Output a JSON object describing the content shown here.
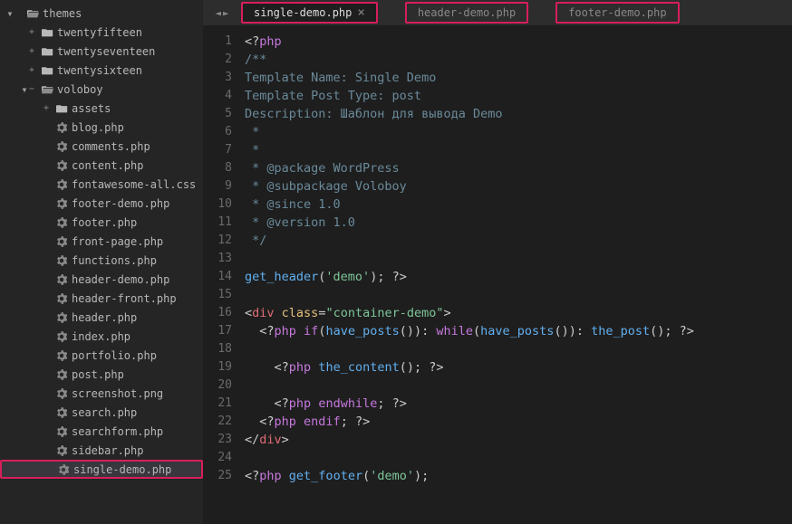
{
  "sidebar": {
    "tree": [
      {
        "depth": 0,
        "chev": "▾",
        "plus": "",
        "type": "folder-open",
        "label": "themes"
      },
      {
        "depth": 1,
        "chev": "",
        "plus": "+",
        "type": "folder",
        "label": "twentyfifteen"
      },
      {
        "depth": 1,
        "chev": "",
        "plus": "+",
        "type": "folder",
        "label": "twentyseventeen"
      },
      {
        "depth": 1,
        "chev": "",
        "plus": "+",
        "type": "folder",
        "label": "twentysixteen"
      },
      {
        "depth": 1,
        "chev": "▾",
        "plus": "−",
        "type": "folder-open",
        "label": "voloboy"
      },
      {
        "depth": 2,
        "chev": "",
        "plus": "+",
        "type": "folder",
        "label": "assets"
      },
      {
        "depth": 2,
        "chev": "",
        "plus": "",
        "type": "gear",
        "label": "blog.php"
      },
      {
        "depth": 2,
        "chev": "",
        "plus": "",
        "type": "gear",
        "label": "comments.php"
      },
      {
        "depth": 2,
        "chev": "",
        "plus": "",
        "type": "gear",
        "label": "content.php"
      },
      {
        "depth": 2,
        "chev": "",
        "plus": "",
        "type": "gear",
        "label": "fontawesome-all.css"
      },
      {
        "depth": 2,
        "chev": "",
        "plus": "",
        "type": "gear",
        "label": "footer-demo.php"
      },
      {
        "depth": 2,
        "chev": "",
        "plus": "",
        "type": "gear",
        "label": "footer.php"
      },
      {
        "depth": 2,
        "chev": "",
        "plus": "",
        "type": "gear",
        "label": "front-page.php"
      },
      {
        "depth": 2,
        "chev": "",
        "plus": "",
        "type": "gear",
        "label": "functions.php"
      },
      {
        "depth": 2,
        "chev": "",
        "plus": "",
        "type": "gear",
        "label": "header-demo.php"
      },
      {
        "depth": 2,
        "chev": "",
        "plus": "",
        "type": "gear",
        "label": "header-front.php"
      },
      {
        "depth": 2,
        "chev": "",
        "plus": "",
        "type": "gear",
        "label": "header.php"
      },
      {
        "depth": 2,
        "chev": "",
        "plus": "",
        "type": "gear",
        "label": "index.php"
      },
      {
        "depth": 2,
        "chev": "",
        "plus": "",
        "type": "gear",
        "label": "portfolio.php"
      },
      {
        "depth": 2,
        "chev": "",
        "plus": "",
        "type": "gear",
        "label": "post.php"
      },
      {
        "depth": 2,
        "chev": "",
        "plus": "",
        "type": "gear",
        "label": "screenshot.png"
      },
      {
        "depth": 2,
        "chev": "",
        "plus": "",
        "type": "gear",
        "label": "search.php"
      },
      {
        "depth": 2,
        "chev": "",
        "plus": "",
        "type": "gear",
        "label": "searchform.php"
      },
      {
        "depth": 2,
        "chev": "",
        "plus": "",
        "type": "gear",
        "label": "sidebar.php"
      },
      {
        "depth": 2,
        "chev": "",
        "plus": "",
        "type": "gear",
        "label": "single-demo.php",
        "selected": true
      }
    ]
  },
  "tabs": {
    "nav_left": "◄",
    "nav_right": "►",
    "items": [
      {
        "label": "single-demo.php",
        "active": true,
        "close": "×"
      },
      {
        "label": "header-demo.php",
        "active": false,
        "close": ""
      },
      {
        "label": "footer-demo.php",
        "active": false,
        "close": ""
      }
    ]
  },
  "editor": {
    "lines": [
      {
        "n": 1,
        "tokens": [
          [
            "op",
            "<?"
          ],
          [
            "kw",
            "php"
          ]
        ]
      },
      {
        "n": 2,
        "tokens": [
          [
            "cm",
            "/**"
          ]
        ]
      },
      {
        "n": 3,
        "tokens": [
          [
            "cm",
            "Template Name: Single Demo"
          ]
        ]
      },
      {
        "n": 4,
        "tokens": [
          [
            "cm",
            "Template Post Type: post"
          ]
        ]
      },
      {
        "n": 5,
        "tokens": [
          [
            "cm",
            "Description: Шаблон для вывода Demo"
          ]
        ]
      },
      {
        "n": 6,
        "tokens": [
          [
            "cm",
            " *"
          ]
        ]
      },
      {
        "n": 7,
        "tokens": [
          [
            "cm",
            " *"
          ]
        ]
      },
      {
        "n": 8,
        "tokens": [
          [
            "cm",
            " * @package WordPress"
          ]
        ]
      },
      {
        "n": 9,
        "tokens": [
          [
            "cm",
            " * @subpackage Voloboy"
          ]
        ]
      },
      {
        "n": 10,
        "tokens": [
          [
            "cm",
            " * @since 1.0"
          ]
        ]
      },
      {
        "n": 11,
        "tokens": [
          [
            "cm",
            " * @version 1.0"
          ]
        ]
      },
      {
        "n": 12,
        "tokens": [
          [
            "cm",
            " */"
          ]
        ]
      },
      {
        "n": 13,
        "tokens": []
      },
      {
        "n": 14,
        "tokens": [
          [
            "fn",
            "get_header"
          ],
          [
            "op",
            "("
          ],
          [
            "str",
            "'demo'"
          ],
          [
            "op",
            ");"
          ],
          [
            "op",
            " ?>"
          ]
        ]
      },
      {
        "n": 15,
        "tokens": []
      },
      {
        "n": 16,
        "tokens": [
          [
            "op",
            "<"
          ],
          [
            "tag",
            "div"
          ],
          [
            "op",
            " "
          ],
          [
            "attr",
            "class"
          ],
          [
            "op",
            "="
          ],
          [
            "str",
            "\"container-demo\""
          ],
          [
            "op",
            ">"
          ]
        ]
      },
      {
        "n": 17,
        "tokens": [
          [
            "op",
            "  <?"
          ],
          [
            "kw",
            "php"
          ],
          [
            "op",
            " "
          ],
          [
            "kw",
            "if"
          ],
          [
            "op",
            "("
          ],
          [
            "fn",
            "have_posts"
          ],
          [
            "op",
            "()): "
          ],
          [
            "kw",
            "while"
          ],
          [
            "op",
            "("
          ],
          [
            "fn",
            "have_posts"
          ],
          [
            "op",
            "()): "
          ],
          [
            "fn",
            "the_post"
          ],
          [
            "op",
            "(); ?>"
          ]
        ]
      },
      {
        "n": 18,
        "tokens": []
      },
      {
        "n": 19,
        "tokens": [
          [
            "op",
            "    <?"
          ],
          [
            "kw",
            "php"
          ],
          [
            "op",
            " "
          ],
          [
            "fn",
            "the_content"
          ],
          [
            "op",
            "(); ?>"
          ]
        ]
      },
      {
        "n": 20,
        "tokens": []
      },
      {
        "n": 21,
        "tokens": [
          [
            "op",
            "    <?"
          ],
          [
            "kw",
            "php"
          ],
          [
            "op",
            " "
          ],
          [
            "kw",
            "endwhile"
          ],
          [
            "op",
            "; ?>"
          ]
        ]
      },
      {
        "n": 22,
        "tokens": [
          [
            "op",
            "  <?"
          ],
          [
            "kw",
            "php"
          ],
          [
            "op",
            " "
          ],
          [
            "kw",
            "endif"
          ],
          [
            "op",
            "; ?>"
          ]
        ]
      },
      {
        "n": 23,
        "tokens": [
          [
            "op",
            "</"
          ],
          [
            "tag",
            "div"
          ],
          [
            "op",
            ">"
          ]
        ]
      },
      {
        "n": 24,
        "tokens": []
      },
      {
        "n": 25,
        "tokens": [
          [
            "op",
            "<?"
          ],
          [
            "kw",
            "php"
          ],
          [
            "op",
            " "
          ],
          [
            "fn",
            "get_footer"
          ],
          [
            "op",
            "("
          ],
          [
            "str",
            "'demo'"
          ],
          [
            "op",
            ");"
          ]
        ]
      }
    ]
  }
}
